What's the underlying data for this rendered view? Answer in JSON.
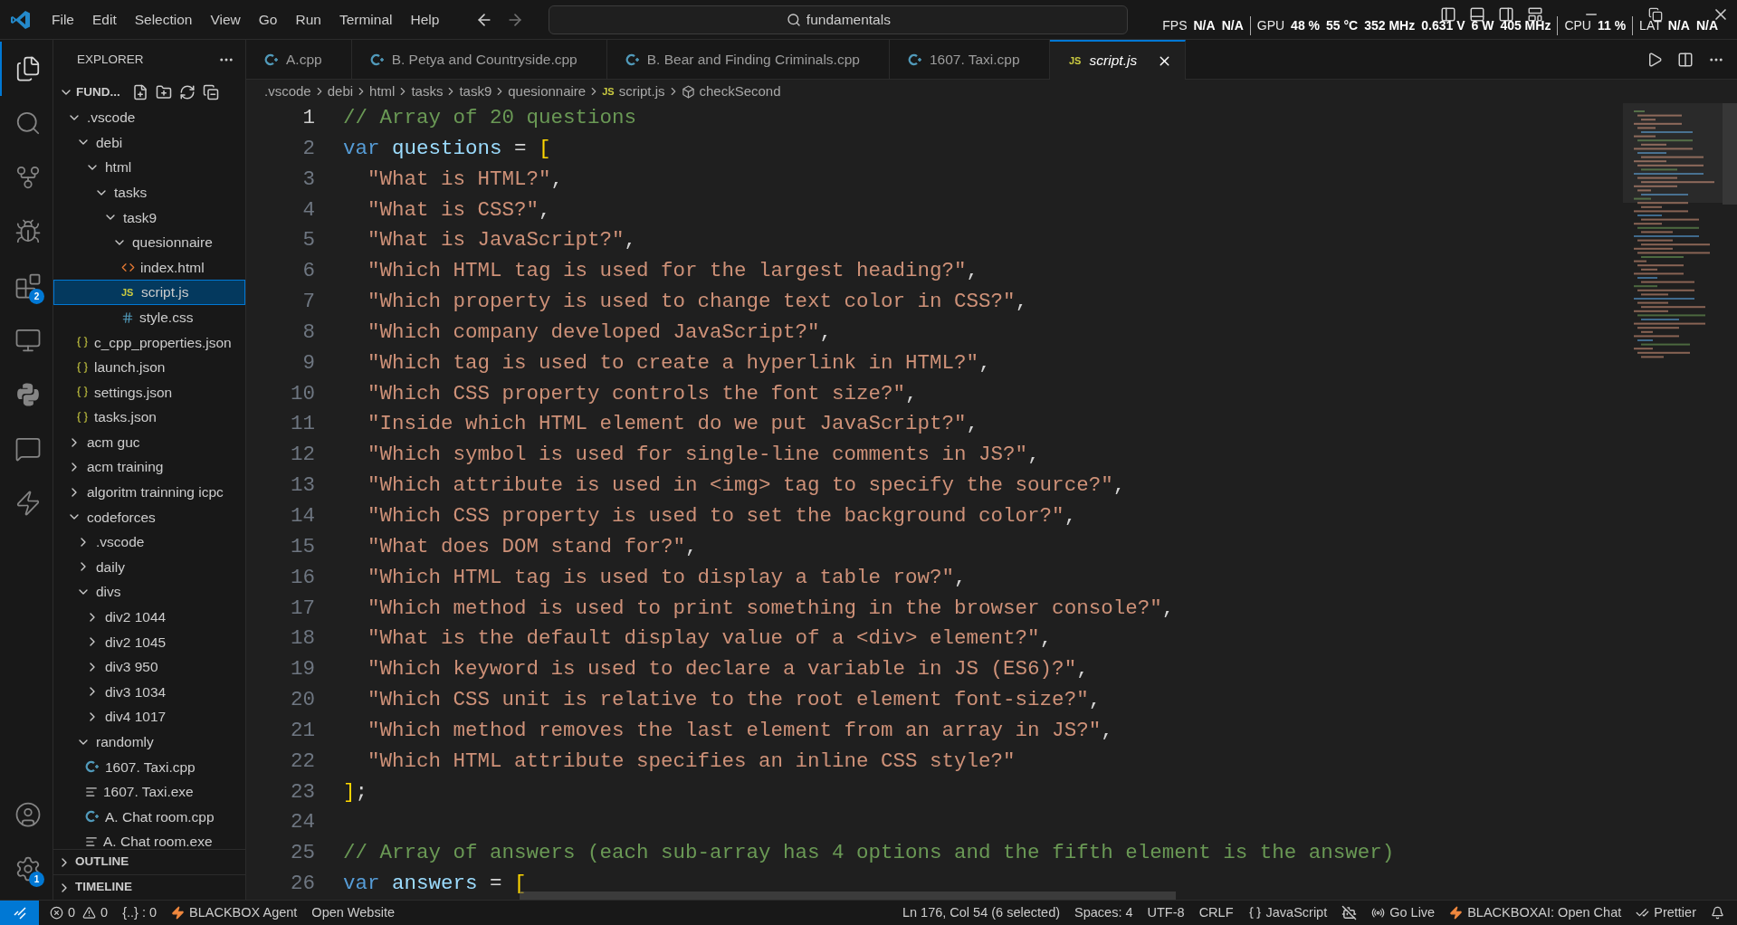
{
  "menu": [
    "File",
    "Edit",
    "Selection",
    "View",
    "Go",
    "Run",
    "Terminal",
    "Help"
  ],
  "search": {
    "value": "fundamentals"
  },
  "perf_overlay": [
    {
      "label": "FPS",
      "values": [
        "N/A",
        "N/A"
      ]
    },
    {
      "label": "GPU",
      "values": [
        "48 %",
        "55 °C",
        "352 MHz",
        "0.631 V",
        "6 W",
        "405 MHz"
      ]
    },
    {
      "label": "CPU",
      "values": [
        "11 %"
      ]
    },
    {
      "label": "LAT",
      "values": [
        "N/A",
        "N/A"
      ]
    }
  ],
  "activity_bar": [
    {
      "kind": "explorer",
      "selected": true
    },
    {
      "kind": "search",
      "selected": false
    },
    {
      "kind": "source-control",
      "selected": false
    },
    {
      "kind": "debug",
      "selected": false
    },
    {
      "kind": "extensions",
      "selected": false,
      "badge": "2"
    },
    {
      "kind": "remote",
      "selected": false
    },
    {
      "kind": "python",
      "selected": false
    },
    {
      "kind": "chat",
      "selected": false
    },
    {
      "kind": "lightning",
      "selected": false
    }
  ],
  "activity_bottom": [
    {
      "kind": "account"
    },
    {
      "kind": "settings",
      "badge": "1"
    }
  ],
  "explorer": {
    "title": "EXPLORER",
    "root": "FUND...",
    "tree": [
      {
        "label": ".vscode",
        "kind": "folder",
        "expanded": true,
        "selected": false,
        "children": [
          {
            "label": "debi",
            "kind": "folder",
            "expanded": true,
            "selected": false,
            "children": [
              {
                "label": "html",
                "kind": "folder",
                "expanded": true,
                "selected": false,
                "children": [
                  {
                    "label": "tasks",
                    "kind": "folder",
                    "expanded": true,
                    "selected": false,
                    "children": [
                      {
                        "label": "task9",
                        "kind": "folder",
                        "expanded": true,
                        "selected": false,
                        "children": [
                          {
                            "label": "quesionnaire",
                            "kind": "folder",
                            "expanded": true,
                            "selected": false,
                            "children": [
                              {
                                "label": "index.html",
                                "kind": "html",
                                "selected": false
                              },
                              {
                                "label": "script.js",
                                "kind": "js",
                                "icon_label": "JS",
                                "selected": true
                              },
                              {
                                "label": "style.css",
                                "kind": "css",
                                "selected": false
                              }
                            ]
                          }
                        ]
                      }
                    ]
                  }
                ]
              }
            ]
          },
          {
            "label": "c_cpp_properties.json",
            "kind": "json",
            "selected": false
          },
          {
            "label": "launch.json",
            "kind": "json",
            "selected": false
          },
          {
            "label": "settings.json",
            "kind": "json",
            "selected": false
          },
          {
            "label": "tasks.json",
            "kind": "json",
            "selected": false
          }
        ]
      },
      {
        "label": "acm guc",
        "kind": "folder",
        "expanded": false,
        "selected": false
      },
      {
        "label": "acm training",
        "kind": "folder",
        "expanded": false,
        "selected": false
      },
      {
        "label": "algoritm trainning icpc",
        "kind": "folder",
        "expanded": false,
        "selected": false
      },
      {
        "label": "codeforces",
        "kind": "folder",
        "expanded": true,
        "selected": false,
        "children": [
          {
            "label": ".vscode",
            "kind": "folder",
            "expanded": false,
            "selected": false
          },
          {
            "label": "daily",
            "kind": "folder",
            "expanded": false,
            "selected": false
          },
          {
            "label": "divs",
            "kind": "folder",
            "expanded": true,
            "selected": false,
            "children": [
              {
                "label": "div2 1044",
                "kind": "folder",
                "expanded": false,
                "selected": false
              },
              {
                "label": "div2 1045",
                "kind": "folder",
                "expanded": false,
                "selected": false
              },
              {
                "label": "div3 950",
                "kind": "folder",
                "expanded": false,
                "selected": false
              },
              {
                "label": "div3 1034",
                "kind": "folder",
                "expanded": false,
                "selected": false
              },
              {
                "label": "div4 1017",
                "kind": "folder",
                "expanded": false,
                "selected": false
              }
            ]
          },
          {
            "label": "randomly",
            "kind": "folder",
            "expanded": true,
            "selected": false,
            "children": [
              {
                "label": "1607. Taxi.cpp",
                "kind": "cpp",
                "selected": false
              },
              {
                "label": "1607. Taxi.exe",
                "kind": "exe",
                "selected": false
              },
              {
                "label": "A. Chat room.cpp",
                "kind": "cpp",
                "selected": false
              },
              {
                "label": "A. Chat room.exe",
                "kind": "exe",
                "selected": false
              }
            ]
          }
        ]
      }
    ],
    "sections": [
      {
        "label": "OUTLINE",
        "expanded": false
      },
      {
        "label": "TIMELINE",
        "expanded": false
      }
    ]
  },
  "tabs": [
    {
      "label": "A.cpp",
      "kind": "cpp",
      "selected": false
    },
    {
      "label": "B. Petya and Countryside.cpp",
      "kind": "cpp",
      "selected": false
    },
    {
      "label": "B. Bear and Finding Criminals.cpp",
      "kind": "cpp",
      "selected": false
    },
    {
      "label": "1607. Taxi.cpp",
      "kind": "cpp",
      "selected": false
    },
    {
      "label": "script.js",
      "kind": "js",
      "icon_label": "JS",
      "selected": true,
      "preview": true
    }
  ],
  "breadcrumbs": [
    {
      "label": ".vscode",
      "kind": "folder"
    },
    {
      "label": "debi",
      "kind": "folder"
    },
    {
      "label": "html",
      "kind": "folder"
    },
    {
      "label": "tasks",
      "kind": "folder"
    },
    {
      "label": "task9",
      "kind": "folder"
    },
    {
      "label": "quesionnaire",
      "kind": "folder"
    },
    {
      "label": "script.js",
      "kind": "js",
      "icon_label": "JS"
    },
    {
      "label": "checkSecond",
      "kind": "symbol"
    }
  ],
  "code": [
    {
      "number": "1",
      "tokens": [
        {
          "kind": "comment",
          "text": "// Array of 20 questions"
        }
      ]
    },
    {
      "number": "2",
      "tokens": [
        {
          "kind": "keyword",
          "text": "var"
        },
        {
          "kind": "variable",
          "text": "questions"
        },
        {
          "kind": "plain",
          "text": " = "
        },
        {
          "kind": "bracket",
          "text": "["
        }
      ]
    },
    {
      "number": "3",
      "indent": true,
      "tokens": [
        {
          "kind": "string",
          "text": "\"What is HTML?\""
        },
        {
          "kind": "plain",
          "text": ","
        }
      ]
    },
    {
      "number": "4",
      "indent": true,
      "tokens": [
        {
          "kind": "string",
          "text": "\"What is CSS?\""
        },
        {
          "kind": "plain",
          "text": ","
        }
      ]
    },
    {
      "number": "5",
      "indent": true,
      "tokens": [
        {
          "kind": "string",
          "text": "\"What is JavaScript?\""
        },
        {
          "kind": "plain",
          "text": ","
        }
      ]
    },
    {
      "number": "6",
      "indent": true,
      "tokens": [
        {
          "kind": "string",
          "text": "\"Which HTML tag is used for the largest heading?\""
        },
        {
          "kind": "plain",
          "text": ","
        }
      ]
    },
    {
      "number": "7",
      "indent": true,
      "tokens": [
        {
          "kind": "string",
          "text": "\"Which property is used to change text color in CSS?\""
        },
        {
          "kind": "plain",
          "text": ","
        }
      ]
    },
    {
      "number": "8",
      "indent": true,
      "tokens": [
        {
          "kind": "string",
          "text": "\"Which company developed JavaScript?\""
        },
        {
          "kind": "plain",
          "text": ","
        }
      ]
    },
    {
      "number": "9",
      "indent": true,
      "tokens": [
        {
          "kind": "string",
          "text": "\"Which tag is used to create a hyperlink in HTML?\""
        },
        {
          "kind": "plain",
          "text": ","
        }
      ]
    },
    {
      "number": "10",
      "indent": true,
      "tokens": [
        {
          "kind": "string",
          "text": "\"Which CSS property controls the font size?\""
        },
        {
          "kind": "plain",
          "text": ","
        }
      ]
    },
    {
      "number": "11",
      "indent": true,
      "tokens": [
        {
          "kind": "string",
          "text": "\"Inside which HTML element do we put JavaScript?\""
        },
        {
          "kind": "plain",
          "text": ","
        }
      ]
    },
    {
      "number": "12",
      "indent": true,
      "tokens": [
        {
          "kind": "string",
          "text": "\"Which symbol is used for single-line comments in JS?\""
        },
        {
          "kind": "plain",
          "text": ","
        }
      ]
    },
    {
      "number": "13",
      "indent": true,
      "tokens": [
        {
          "kind": "string",
          "text": "\"Which attribute is used in <img> tag to specify the source?\""
        },
        {
          "kind": "plain",
          "text": ","
        }
      ]
    },
    {
      "number": "14",
      "indent": true,
      "tokens": [
        {
          "kind": "string",
          "text": "\"Which CSS property is used to set the background color?\""
        },
        {
          "kind": "plain",
          "text": ","
        }
      ]
    },
    {
      "number": "15",
      "indent": true,
      "tokens": [
        {
          "kind": "string",
          "text": "\"What does DOM stand for?\""
        },
        {
          "kind": "plain",
          "text": ","
        }
      ]
    },
    {
      "number": "16",
      "indent": true,
      "tokens": [
        {
          "kind": "string",
          "text": "\"Which HTML tag is used to display a table row?\""
        },
        {
          "kind": "plain",
          "text": ","
        }
      ]
    },
    {
      "number": "17",
      "indent": true,
      "tokens": [
        {
          "kind": "string",
          "text": "\"Which method is used to print something in the browser console?\""
        },
        {
          "kind": "plain",
          "text": ","
        }
      ]
    },
    {
      "number": "18",
      "indent": true,
      "tokens": [
        {
          "kind": "string",
          "text": "\"What is the default display value of a <div> element?\""
        },
        {
          "kind": "plain",
          "text": ","
        }
      ]
    },
    {
      "number": "19",
      "indent": true,
      "tokens": [
        {
          "kind": "string",
          "text": "\"Which keyword is used to declare a variable in JS (ES6)?\""
        },
        {
          "kind": "plain",
          "text": ","
        }
      ]
    },
    {
      "number": "20",
      "indent": true,
      "tokens": [
        {
          "kind": "string",
          "text": "\"Which CSS unit is relative to the root element font-size?\""
        },
        {
          "kind": "plain",
          "text": ","
        }
      ]
    },
    {
      "number": "21",
      "indent": true,
      "tokens": [
        {
          "kind": "string",
          "text": "\"Which method removes the last element from an array in JS?\""
        },
        {
          "kind": "plain",
          "text": ","
        }
      ]
    },
    {
      "number": "22",
      "indent": true,
      "tokens": [
        {
          "kind": "string",
          "text": "\"Which HTML attribute specifies an inline CSS style?\""
        }
      ]
    },
    {
      "number": "23",
      "tokens": [
        {
          "kind": "bracket",
          "text": "]"
        },
        {
          "kind": "plain",
          "text": ";"
        }
      ]
    },
    {
      "number": "24"
    },
    {
      "number": "25",
      "tokens": [
        {
          "kind": "comment",
          "text": "// Array of answers (each sub-array has 4 options and the fifth element is the answer)"
        }
      ]
    },
    {
      "number": "26",
      "tokens": [
        {
          "kind": "keyword",
          "text": "var"
        },
        {
          "kind": "variable",
          "text": "answers"
        },
        {
          "kind": "plain",
          "text": " = "
        },
        {
          "kind": "bracket",
          "text": "["
        }
      ]
    }
  ],
  "status_bar": {
    "left": [
      {
        "kind": "errors",
        "text": "0"
      },
      {
        "kind": "warnings",
        "text": "0"
      },
      {
        "kind": "plain",
        "text": "{..} : 0"
      },
      {
        "kind": "bolt",
        "text": "BLACKBOX Agent"
      },
      {
        "kind": "plain",
        "text": "Open Website"
      }
    ],
    "right": [
      {
        "kind": "plain",
        "text": "Ln 176, Col 54 (6 selected)"
      },
      {
        "kind": "plain",
        "text": "Spaces: 4"
      },
      {
        "kind": "plain",
        "text": "UTF-8"
      },
      {
        "kind": "plain",
        "text": "CRLF"
      },
      {
        "kind": "language",
        "text": "JavaScript"
      },
      {
        "kind": "copilot"
      },
      {
        "kind": "golive",
        "text": "Go Live"
      },
      {
        "kind": "bolt",
        "text": "BLACKBOXAI: Open Chat"
      },
      {
        "kind": "prettier",
        "text": "Prettier"
      },
      {
        "kind": "bell"
      }
    ]
  }
}
